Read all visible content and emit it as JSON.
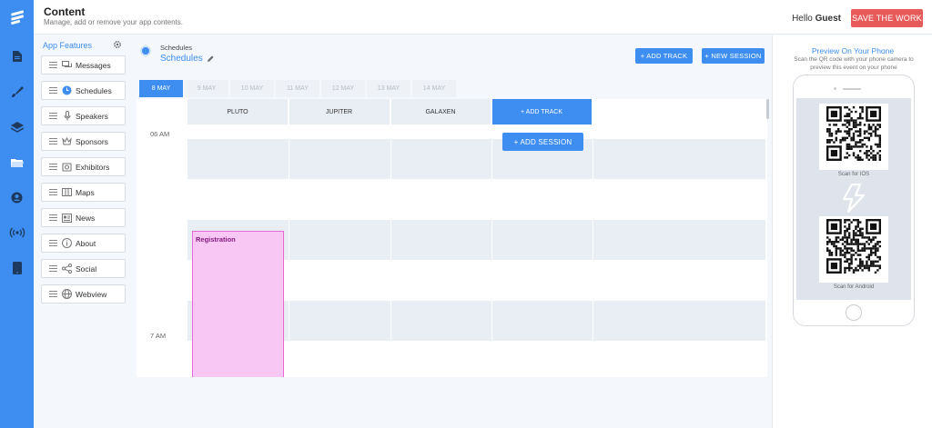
{
  "header": {
    "title": "Content",
    "subtitle": "Manage, add or remove your app contents.",
    "hello": "Hello",
    "user": "Guest",
    "save_label": "SAVE THE WORK"
  },
  "rail": {
    "icons": [
      "logo-icon",
      "document-icon",
      "brush-icon",
      "layers-icon",
      "folder-icon",
      "user-icon",
      "broadcast-icon",
      "phone-icon"
    ],
    "accent": "#3d8ef0"
  },
  "features": {
    "title": "App Features",
    "items": [
      {
        "label": "Messages",
        "icon": "chat-icon"
      },
      {
        "label": "Schedules",
        "icon": "clock-icon"
      },
      {
        "label": "Speakers",
        "icon": "mic-icon"
      },
      {
        "label": "Sponsors",
        "icon": "crown-icon"
      },
      {
        "label": "Exhibitors",
        "icon": "store-icon"
      },
      {
        "label": "Maps",
        "icon": "map-icon"
      },
      {
        "label": "News",
        "icon": "news-icon"
      },
      {
        "label": "About",
        "icon": "info-icon"
      },
      {
        "label": "Social",
        "icon": "share-icon"
      },
      {
        "label": "Webview",
        "icon": "globe-icon"
      }
    ]
  },
  "schedule": {
    "breadcrumb": "Schedules",
    "title": "Schedules",
    "add_track_label": "+ ADD TRACK",
    "new_session_label": "+ NEW SESSION",
    "dates": [
      "8 MAY",
      "9 MAY",
      "10 MAY",
      "11 MAY",
      "12 MAY",
      "13 MAY",
      "14 MAY"
    ],
    "active_date": "8 MAY",
    "tracks": [
      "PLUTO",
      "JUPITER",
      "GALAXEN"
    ],
    "grid_add_track": "+ ADD TRACK",
    "add_session": "+ ADD SESSION",
    "times": [
      "06 AM",
      "7 AM"
    ],
    "session": {
      "title": "Registration",
      "track": "PLUTO",
      "color": "#f9c7f3"
    }
  },
  "preview": {
    "title": "Preview On Your Phone",
    "description": "Scan the QR code with your phone camera to preview this event on your phone",
    "ios_label": "Scan for IOS",
    "android_label": "Scan for Android"
  }
}
